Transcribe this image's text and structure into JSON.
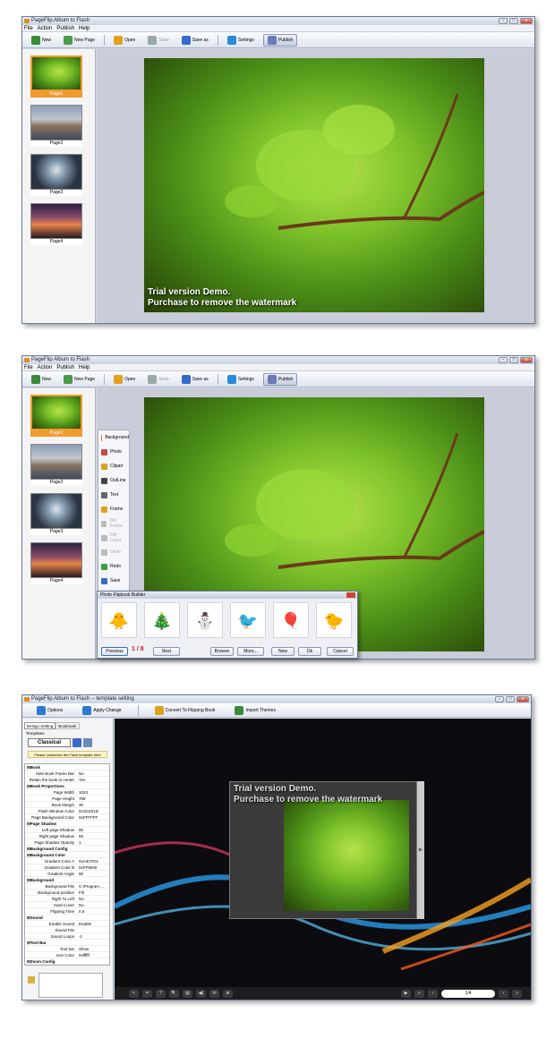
{
  "window1": {
    "title": "PageFlip Album to Flash",
    "menu": [
      "File",
      "Action",
      "Publish",
      "Help"
    ],
    "toolbar": [
      {
        "label": "New",
        "color": "#3a8a3a"
      },
      {
        "label": "New Page",
        "color": "#4a9a4a"
      },
      {
        "label": "Open",
        "color": "#e0a020"
      },
      {
        "label": "Save",
        "color": "#9aa"
      },
      {
        "label": "Save as",
        "color": "#3a6ac8"
      },
      {
        "label": "Settings",
        "color": "#2a8ad8"
      },
      {
        "label": "Publish",
        "color": "#6a7ab8"
      }
    ],
    "thumbs": [
      "Page1",
      "Page2",
      "Page3",
      "Page4"
    ],
    "watermark_line1": "Trial version Demo.",
    "watermark_line2": "Purchase to remove the watermark"
  },
  "window2": {
    "title": "PageFlip Album to Flash",
    "menu": [
      "File",
      "Action",
      "Publish",
      "Help"
    ],
    "toolbar": [
      {
        "label": "New",
        "color": "#3a8a3a"
      },
      {
        "label": "New Page",
        "color": "#4a9a4a"
      },
      {
        "label": "Open",
        "color": "#e0a020"
      },
      {
        "label": "Save",
        "color": "#9aa"
      },
      {
        "label": "Save as",
        "color": "#3a6ac8"
      },
      {
        "label": "Settings",
        "color": "#2a8ad8"
      },
      {
        "label": "Publish",
        "color": "#6a7ab8"
      }
    ],
    "thumbs": [
      "Page1",
      "Page2",
      "Page3",
      "Page4"
    ],
    "tools": [
      {
        "label": "Background",
        "color": "#e07a20"
      },
      {
        "label": "Photo",
        "color": "#c84a4a"
      },
      {
        "label": "Clipart",
        "color": "#d8a020"
      },
      {
        "label": "OutLine",
        "color": "#444"
      },
      {
        "label": "Text",
        "color": "#666"
      },
      {
        "label": "Frame",
        "color": "#e0a020"
      },
      {
        "label": "Del Frame",
        "color": "#bbb"
      },
      {
        "label": "Del Layer",
        "color": "#bbb"
      },
      {
        "label": "Undo",
        "color": "#bbb"
      },
      {
        "label": "Redo",
        "color": "#3aa03a"
      },
      {
        "label": "Save",
        "color": "#3a6ac8"
      }
    ],
    "dialog": {
      "title": "Photo Flipbook Builder",
      "cliparts": [
        "🐥",
        "🎄",
        "⛄",
        "🐦",
        "🎈",
        "🐤"
      ],
      "previous": "Previous",
      "page": "1",
      "sep": "/",
      "total": "8",
      "next": "Next",
      "browse": "Browse",
      "more": "More...",
      "new": "New",
      "ok": "Ok",
      "cancel": "Cancel"
    }
  },
  "window3": {
    "title": "PageFlip Album to Flash -- template setting",
    "toolbar": [
      {
        "label": "Options",
        "color": "#2a7ad0"
      },
      {
        "label": "Apply Change",
        "color": "#2a7ad0"
      },
      {
        "label": "Convert To Flipping Book",
        "color": "#e0a020"
      },
      {
        "label": "Import Themes",
        "color": "#3a8a3a"
      }
    ],
    "tabs": [
      "Design Setting",
      "Bookmark"
    ],
    "templates_label": "Templates",
    "template_name": "Classical",
    "customize_note": "Please customize the Flash template here",
    "props": [
      {
        "k": "⊟Book",
        "v": "",
        "g": true
      },
      {
        "k": "Hide Book Frame Bar",
        "v": "No"
      },
      {
        "k": "Retain the book to center",
        "v": "Yes"
      },
      {
        "k": "⊟Book Proportions",
        "v": "",
        "g": true
      },
      {
        "k": "Page Width",
        "v": "1024"
      },
      {
        "k": "Page Height",
        "v": "768"
      },
      {
        "k": "Book Margin",
        "v": "30"
      },
      {
        "k": "Flash Window Color",
        "v": "0x1D1D1D"
      },
      {
        "k": "Page Background Color",
        "v": "0xFFFFFF"
      },
      {
        "k": "⊟Page Shadow",
        "v": "",
        "g": true
      },
      {
        "k": "Left page Shadow",
        "v": "90"
      },
      {
        "k": "Right page Shadow",
        "v": "55"
      },
      {
        "k": "Page Shadow Opacity",
        "v": "1"
      },
      {
        "k": "⊟Background Config",
        "v": "",
        "g": true
      },
      {
        "k": "⊟Background Color",
        "v": "",
        "g": true
      },
      {
        "k": "Gradient Color A",
        "v": "0xA3CFD1"
      },
      {
        "k": "Gradient Color B",
        "v": "0xFF8040"
      },
      {
        "k": "Gradient Angle",
        "v": "90"
      },
      {
        "k": "⊟Background",
        "v": "",
        "g": true
      },
      {
        "k": "Background File",
        "v": "C:\\Program ..."
      },
      {
        "k": "Background position",
        "v": "Fill"
      },
      {
        "k": "Right To Left",
        "v": "No"
      },
      {
        "k": "Hard Cover",
        "v": "No"
      },
      {
        "k": "Flipping Time",
        "v": "0.6"
      },
      {
        "k": "⊟Sound",
        "v": "",
        "g": true
      },
      {
        "k": "Enable Sound",
        "v": "Enable"
      },
      {
        "k": "Sound File",
        "v": ""
      },
      {
        "k": "Sound Loops",
        "v": "-1"
      },
      {
        "k": "⊟Tool Bar",
        "v": "",
        "g": true
      },
      {
        "k": "Tool bar",
        "v": "Show"
      },
      {
        "k": "Icon Color",
        "v": "0xffffff"
      },
      {
        "k": "⊟Zoom Config",
        "v": "",
        "g": true
      }
    ],
    "watermark_line1": "Trial version Demo.",
    "watermark_line2": "Purchase to remove the watermark",
    "bar_buttons": [
      "↖",
      "⌗",
      "?",
      "🔍",
      "▤",
      "◀)",
      "✉",
      "⊕"
    ],
    "nav_buttons": [
      "▶",
      "«",
      "‹"
    ],
    "page_indicator": "1/4",
    "nav_end": [
      "›",
      "»"
    ]
  }
}
